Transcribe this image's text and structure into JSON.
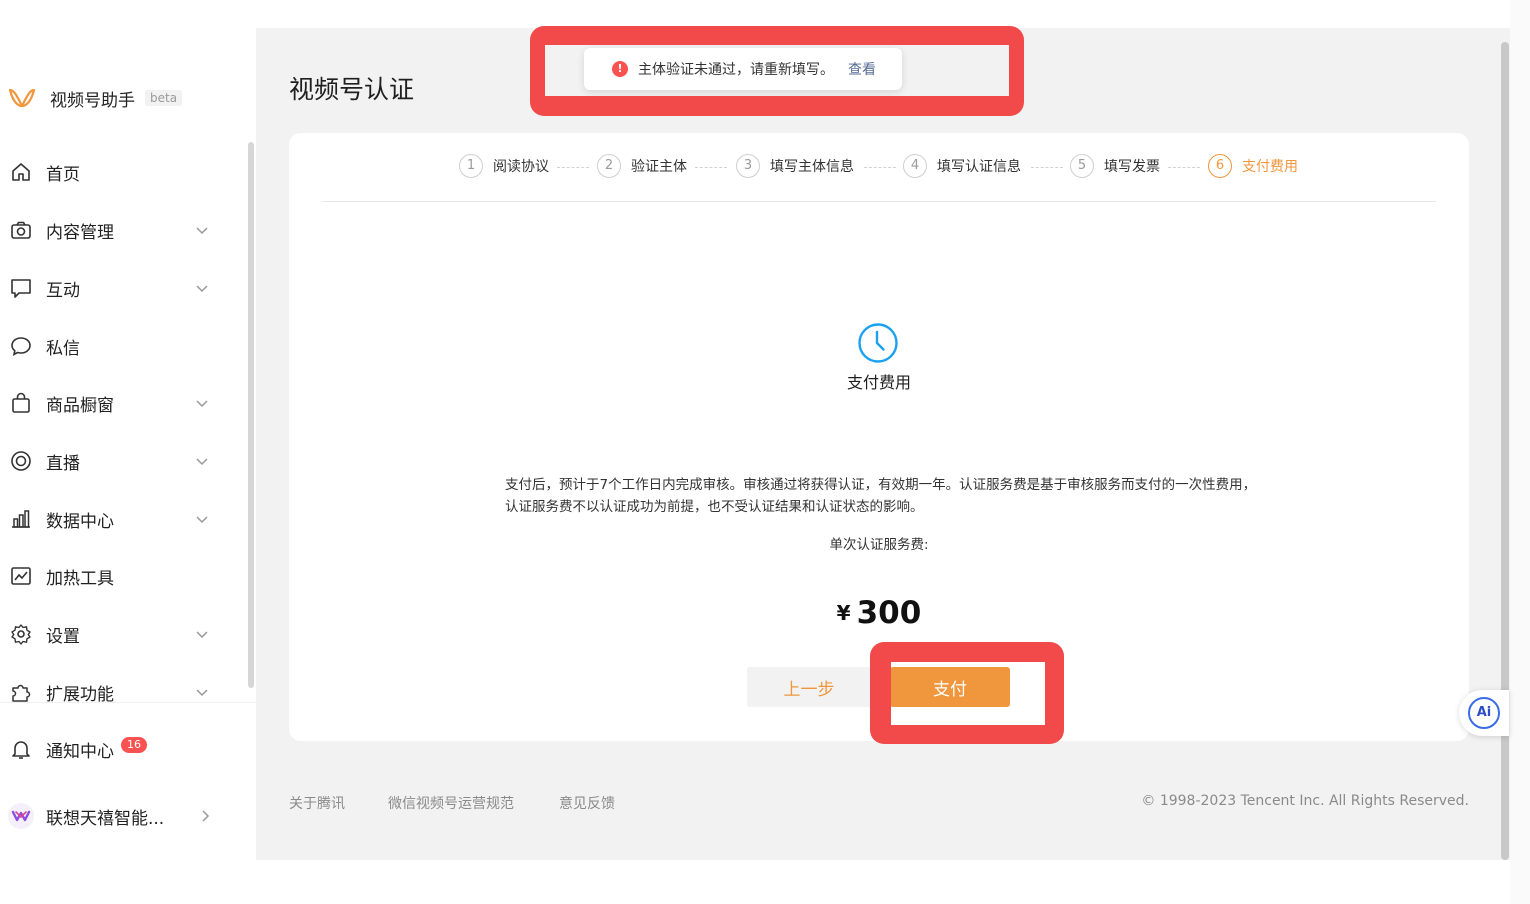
{
  "brand": {
    "name": "视频号助手",
    "beta": "beta"
  },
  "sidebar": {
    "items": [
      {
        "label": "首页",
        "icon": "home-icon",
        "expandable": false
      },
      {
        "label": "内容管理",
        "icon": "camera-icon",
        "expandable": true
      },
      {
        "label": "互动",
        "icon": "comment-icon",
        "expandable": true
      },
      {
        "label": "私信",
        "icon": "message-icon",
        "expandable": false
      },
      {
        "label": "商品橱窗",
        "icon": "shopping-bag-icon",
        "expandable": true
      },
      {
        "label": "直播",
        "icon": "live-icon",
        "expandable": true
      },
      {
        "label": "数据中心",
        "icon": "bar-chart-icon",
        "expandable": true
      },
      {
        "label": "加热工具",
        "icon": "trend-icon",
        "expandable": false
      },
      {
        "label": "设置",
        "icon": "gear-icon",
        "expandable": true
      },
      {
        "label": "扩展功能",
        "icon": "puzzle-icon",
        "expandable": true
      }
    ],
    "notification": {
      "label": "通知中心",
      "badge": "16",
      "icon": "bell-icon"
    },
    "account": {
      "name": "联想天禧智能...",
      "icon": "account-avatar-icon"
    }
  },
  "page": {
    "title": "视频号认证"
  },
  "toast": {
    "message": "主体验证未通过，请重新填写。",
    "link": "查看",
    "icon": "error-icon",
    "color": "#fa5151"
  },
  "steps": [
    {
      "num": "1",
      "label": "阅读协议"
    },
    {
      "num": "2",
      "label": "验证主体"
    },
    {
      "num": "3",
      "label": "填写主体信息"
    },
    {
      "num": "4",
      "label": "填写认证信息"
    },
    {
      "num": "5",
      "label": "填写发票"
    },
    {
      "num": "6",
      "label": "支付费用",
      "active": true
    }
  ],
  "payment": {
    "status_icon": "clock-icon",
    "title": "支付费用",
    "description": "支付后，预计于7个工作日内完成审核。审核通过将获得认证，有效期一年。认证服务费是基于审核服务而支付的一次性费用，认证服务费不以认证成功为前提，也不受认证结果和认证状态的影响。",
    "fee_label": "单次认证服务费:",
    "currency": "¥",
    "amount": "300",
    "prev_button": "上一步",
    "pay_button": "支付"
  },
  "footer": {
    "links": [
      "关于腾讯",
      "微信视频号运营规范",
      "意见反馈"
    ],
    "copyright": "© 1998-2023 Tencent Inc. All Rights Reserved."
  },
  "ai_assistant": {
    "label": "Ai"
  },
  "colors": {
    "accent": "#f0963c",
    "error": "#fa5151",
    "link": "#576b95",
    "highlight": "#f24a4a",
    "background": "#f2f2f2"
  }
}
